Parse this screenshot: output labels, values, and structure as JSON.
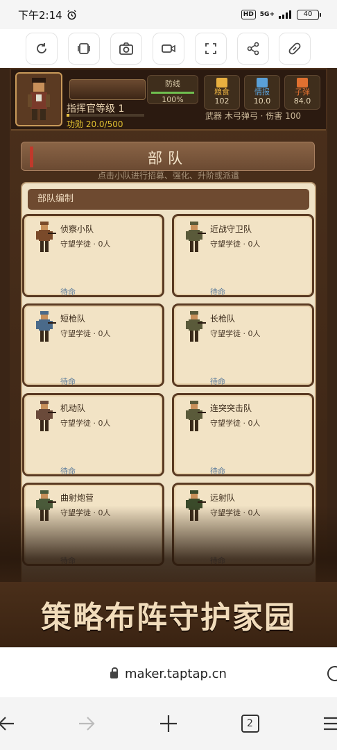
{
  "statusbar": {
    "time": "下午2:14",
    "network": "5G+",
    "hd": "HD",
    "battery": "40"
  },
  "toolbar": {
    "icons": [
      "refresh-icon",
      "screen-icon",
      "camera-icon",
      "video-icon",
      "fullscreen-icon",
      "share-icon",
      "link-icon"
    ]
  },
  "hud": {
    "commander_level": "指挥官等级 1",
    "merit": "功勋 20.0/500",
    "merit_progress": 0.04,
    "defense": {
      "label": "防线",
      "value": "100%",
      "progress": 1.0
    },
    "resources": [
      {
        "label": "粮食",
        "value": "102",
        "color": "#e8b040"
      },
      {
        "label": "情报",
        "value": "10.0",
        "color": "#5aa0d8"
      },
      {
        "label": "子弹",
        "value": "84.0",
        "color": "#e07030"
      }
    ],
    "weapon": "武器 木弓弹弓",
    "damage": "伤害 100"
  },
  "section": {
    "title": "部队",
    "hint": "点击小队进行招募、强化、升阶或派遣",
    "panel_header": "部队编制"
  },
  "units": [
    {
      "name": "侦察小队",
      "soldier": "守望学徒",
      "count": "0人",
      "status": "待命"
    },
    {
      "name": "近战守卫队",
      "soldier": "守望学徒",
      "count": "0人",
      "status": "待命"
    },
    {
      "name": "短枪队",
      "soldier": "守望学徒",
      "count": "0人",
      "status": "待命"
    },
    {
      "name": "长枪队",
      "soldier": "守望学徒",
      "count": "0人",
      "status": "待命"
    },
    {
      "name": "机动队",
      "soldier": "守望学徒",
      "count": "0人",
      "status": "待命"
    },
    {
      "name": "连突突击队",
      "soldier": "守望学徒",
      "count": "0人",
      "status": "待命"
    },
    {
      "name": "曲射炮营",
      "soldier": "守望学徒",
      "count": "0人",
      "status": "待命"
    },
    {
      "name": "远射队",
      "soldier": "守望学徒",
      "count": "0人",
      "status": "待命"
    }
  ],
  "slogan": "策略布阵守护家园",
  "browser": {
    "url": "maker.taptap.cn",
    "tab_count": "2"
  }
}
